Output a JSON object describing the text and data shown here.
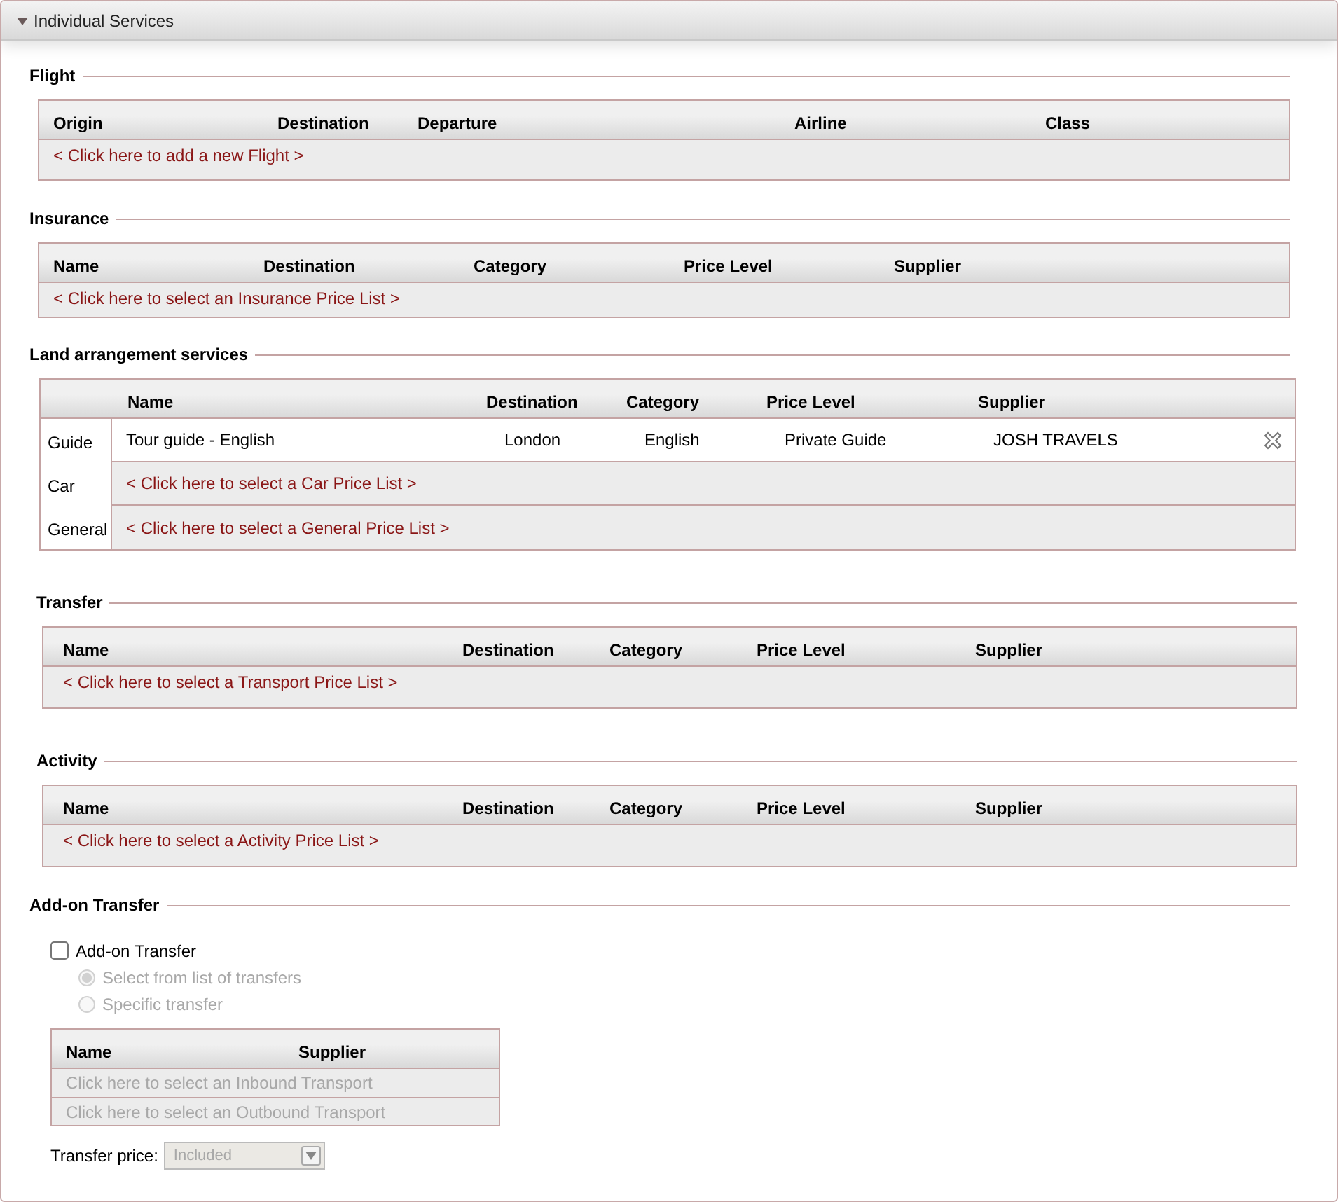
{
  "panel": {
    "title": "Individual Services",
    "expanded": true
  },
  "sections": [
    {
      "kind": "grid",
      "legend": "Flight",
      "columns": [
        "Origin",
        "Destination",
        "Departure",
        "Airline",
        "Class"
      ],
      "rows": [
        {
          "kind": "prompt",
          "text": "< Click here to add a new Flight >"
        }
      ]
    },
    {
      "kind": "grid",
      "legend": "Insurance",
      "columns": [
        "Name",
        "Destination",
        "Category",
        "Price Level",
        "Supplier"
      ],
      "rows": [
        {
          "kind": "prompt",
          "text": "< Click here to select an Insurance Price List >"
        }
      ]
    },
    {
      "kind": "grouped",
      "legend": "Land arrangement services",
      "columns": [
        "Name",
        "Destination",
        "Category",
        "Price Level",
        "Supplier"
      ],
      "groups": [
        {
          "label": "Guide",
          "row": {
            "kind": "item",
            "cells": [
              "Tour guide - English",
              "London",
              "English",
              "Private Guide",
              "JOSH TRAVELS"
            ]
          }
        },
        {
          "label": "Car",
          "row": {
            "kind": "prompt",
            "text": "< Click here to select a Car Price List >"
          }
        },
        {
          "label": "General",
          "row": {
            "kind": "prompt",
            "text": "< Click here to select a General Price List >"
          }
        }
      ]
    },
    {
      "kind": "grid",
      "legend": "Transfer",
      "columns": [
        "Name",
        "Destination",
        "Category",
        "Price Level",
        "Supplier"
      ],
      "rows": [
        {
          "kind": "prompt",
          "text": "< Click here to select a Transport Price List >"
        }
      ]
    },
    {
      "kind": "grid",
      "legend": "Activity",
      "columns": [
        "Name",
        "Destination",
        "Category",
        "Price Level",
        "Supplier"
      ],
      "rows": [
        {
          "kind": "prompt",
          "text": "< Click here to select a Activity Price List >"
        }
      ]
    },
    {
      "kind": "addon",
      "legend": "Add-on Transfer",
      "checkbox": {
        "label": "Add-on Transfer",
        "checked": false
      },
      "options": [
        {
          "label": "Select from list of transfers",
          "selected": true,
          "disabled": true
        },
        {
          "label": "Specific transfer",
          "selected": false,
          "disabled": true
        }
      ],
      "columns": [
        "Name",
        "Supplier"
      ],
      "rows": [
        {
          "text": "Click here to select an Inbound Transport",
          "disabled": true
        },
        {
          "text": "Click here to select an Outbound Transport",
          "disabled": true
        }
      ],
      "price": {
        "label": "Transfer price:",
        "value": "Included",
        "disabled": true
      }
    }
  ]
}
